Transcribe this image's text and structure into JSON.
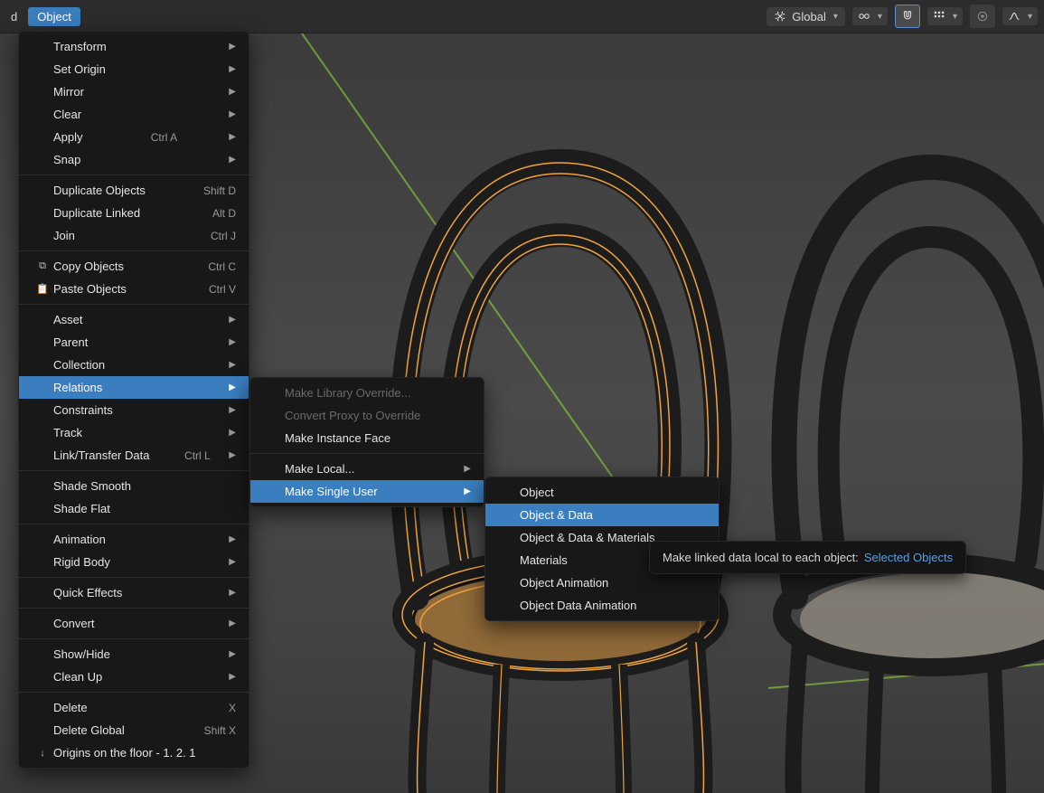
{
  "header": {
    "left_cut": "d",
    "object_btn": "Object",
    "orientation_label": "Global"
  },
  "object_menu": {
    "transform": "Transform",
    "set_origin": "Set Origin",
    "mirror": "Mirror",
    "clear": "Clear",
    "apply": "Apply",
    "apply_sc": "Ctrl A",
    "snap": "Snap",
    "dup_objects": "Duplicate Objects",
    "dup_objects_sc": "Shift D",
    "dup_linked": "Duplicate Linked",
    "dup_linked_sc": "Alt D",
    "join": "Join",
    "join_sc": "Ctrl J",
    "copy": "Copy Objects",
    "copy_sc": "Ctrl C",
    "paste": "Paste Objects",
    "paste_sc": "Ctrl V",
    "asset": "Asset",
    "parent": "Parent",
    "collection": "Collection",
    "relations": "Relations",
    "constraints": "Constraints",
    "track": "Track",
    "link_transfer": "Link/Transfer Data",
    "link_transfer_sc": "Ctrl L",
    "shade_smooth": "Shade Smooth",
    "shade_flat": "Shade Flat",
    "animation": "Animation",
    "rigid_body": "Rigid Body",
    "quick_effects": "Quick Effects",
    "convert": "Convert",
    "show_hide": "Show/Hide",
    "clean_up": "Clean Up",
    "delete": "Delete",
    "delete_sc": "X",
    "delete_global": "Delete Global",
    "delete_global_sc": "Shift X",
    "last_op": "Origins on the floor - 1. 2. 1"
  },
  "relations_menu": {
    "make_lib_override": "Make Library Override...",
    "convert_proxy": "Convert Proxy to Override",
    "make_instance_face": "Make Instance Face",
    "make_local": "Make Local...",
    "make_single_user": "Make Single User"
  },
  "single_user_menu": {
    "object": "Object",
    "object_data": "Object & Data",
    "object_data_mat": "Object & Data & Materials",
    "materials": "Materials",
    "obj_anim": "Object Animation",
    "obj_data_anim": "Object Data Animation"
  },
  "tooltip": {
    "text": "Make linked data local to each object:",
    "selected": "Selected Objects"
  }
}
